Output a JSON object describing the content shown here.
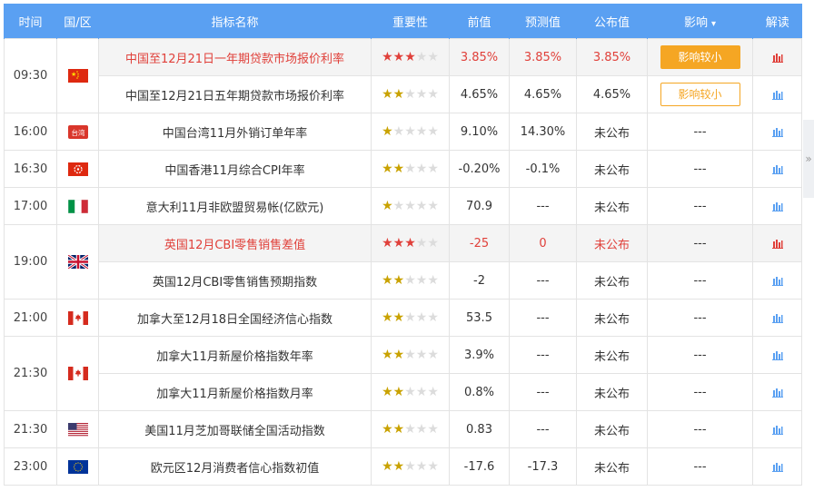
{
  "header": {
    "time": "时间",
    "country": "国/区",
    "indicator": "指标名称",
    "importance": "重要性",
    "previous": "前值",
    "forecast": "预测值",
    "actual": "公布值",
    "impact": "影响",
    "read": "解读"
  },
  "side_tab_glyph": "»",
  "groups": [
    {
      "time": "09:30",
      "flag": "china-flag-icon",
      "rows": [
        {
          "name": "中国至12月21日一年期贷款市场报价利率",
          "stars": 3,
          "prev": "3.85%",
          "forecast": "3.85%",
          "actual": "3.85%",
          "impact": "影响较小",
          "impact_style": "fill",
          "hot": true
        },
        {
          "name": "中国至12月21日五年期贷款市场报价利率",
          "stars": 2,
          "prev": "4.65%",
          "forecast": "4.65%",
          "actual": "4.65%",
          "impact": "影响较小",
          "impact_style": "line",
          "hot": false
        }
      ]
    },
    {
      "time": "16:00",
      "flag": "taiwan-label-icon",
      "flag_text": "台湾",
      "rows": [
        {
          "name": "中国台湾11月外销订单年率",
          "stars": 1,
          "prev": "9.10%",
          "forecast": "14.30%",
          "actual": "未公布",
          "impact": "---"
        }
      ]
    },
    {
      "time": "16:30",
      "flag": "hong-kong-flag-icon",
      "rows": [
        {
          "name": "中国香港11月综合CPI年率",
          "stars": 2,
          "prev": "-0.20%",
          "forecast": "-0.1%",
          "actual": "未公布",
          "impact": "---"
        }
      ]
    },
    {
      "time": "17:00",
      "flag": "italy-flag-icon",
      "rows": [
        {
          "name": "意大利11月非欧盟贸易帐(亿欧元)",
          "stars": 1,
          "prev": "70.9",
          "forecast": "---",
          "actual": "未公布",
          "impact": "---"
        }
      ]
    },
    {
      "time": "19:00",
      "flag": "uk-flag-icon",
      "rows": [
        {
          "name": "英国12月CBI零售销售差值",
          "stars": 3,
          "prev": "-25",
          "forecast": "0",
          "actual": "未公布",
          "impact": "---",
          "hot": true
        },
        {
          "name": "英国12月CBI零售销售预期指数",
          "stars": 2,
          "prev": "-2",
          "forecast": "---",
          "actual": "未公布",
          "impact": "---"
        }
      ]
    },
    {
      "time": "21:00",
      "flag": "canada-flag-icon",
      "rows": [
        {
          "name": "加拿大至12月18日全国经济信心指数",
          "stars": 2,
          "prev": "53.5",
          "forecast": "---",
          "actual": "未公布",
          "impact": "---"
        }
      ]
    },
    {
      "time": "21:30",
      "flag": "canada-flag-icon",
      "rows": [
        {
          "name": "加拿大11月新屋价格指数年率",
          "stars": 2,
          "prev": "3.9%",
          "forecast": "---",
          "actual": "未公布",
          "impact": "---"
        },
        {
          "name": "加拿大11月新屋价格指数月率",
          "stars": 2,
          "prev": "0.8%",
          "forecast": "---",
          "actual": "未公布",
          "impact": "---"
        }
      ]
    },
    {
      "time": "21:30",
      "flag": "usa-flag-icon",
      "rows": [
        {
          "name": "美国11月芝加哥联储全国活动指数",
          "stars": 2,
          "prev": "0.83",
          "forecast": "---",
          "actual": "未公布",
          "impact": "---"
        }
      ]
    },
    {
      "time": "23:00",
      "flag": "eu-flag-icon",
      "rows": [
        {
          "name": "欧元区12月消费者信心指数初值",
          "stars": 2,
          "prev": "-17.6",
          "forecast": "-17.3",
          "actual": "未公布",
          "impact": "---"
        }
      ]
    }
  ],
  "colors": {
    "header_bg": "#5aa0f2",
    "hot_text": "#e0403a",
    "impact_orange": "#f5a623",
    "read_icon": "#5aa0f2",
    "read_icon_hot": "#e0403a"
  }
}
